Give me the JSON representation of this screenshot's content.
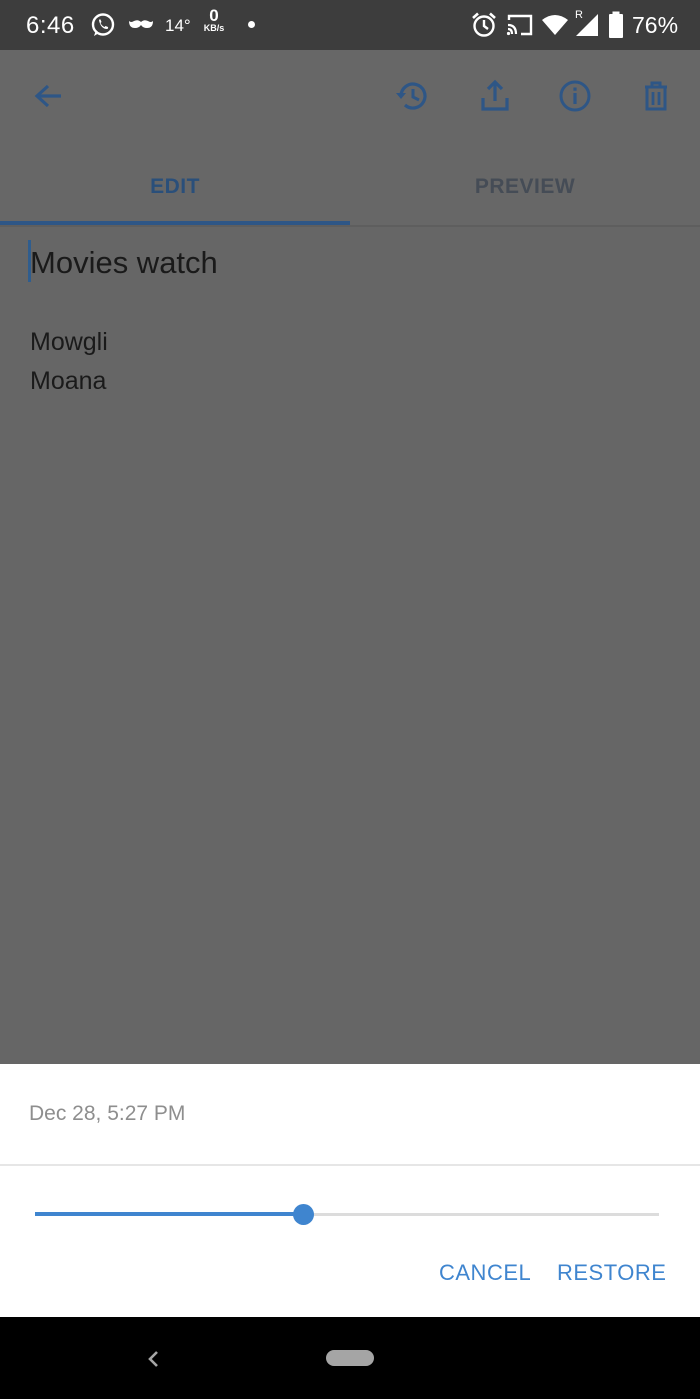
{
  "status_bar": {
    "time": "6:46",
    "temperature": "14°",
    "network_speed_value": "0",
    "network_speed_unit": "KB/s",
    "roaming_indicator": "R",
    "battery_percent": "76%",
    "icons": [
      "whatsapp-icon",
      "mustache-icon",
      "dot-icon",
      "alarm-icon",
      "cast-icon",
      "wifi-icon",
      "signal-icon",
      "battery-icon"
    ]
  },
  "app_bar": {
    "icons": [
      "back-arrow-icon",
      "history-icon",
      "share-icon",
      "info-icon",
      "delete-icon"
    ],
    "tabs": [
      {
        "label": "EDIT",
        "selected": true
      },
      {
        "label": "PREVIEW",
        "selected": false
      }
    ]
  },
  "note": {
    "title": "Movies watch",
    "lines": [
      "Mowgli",
      "Moana"
    ]
  },
  "history_sheet": {
    "timestamp": "Dec 28, 5:27 PM",
    "slider_position_fraction": 0.43,
    "cancel_label": "CANCEL",
    "restore_label": "RESTORE"
  },
  "colors": {
    "accent": "#3f85cf",
    "appbar_icon": "#2e5686",
    "scrim": "#666666",
    "status_bar": "#3d3d3d"
  },
  "nav_bar": {
    "icons": [
      "nav-back-icon",
      "nav-home-pill-icon"
    ]
  }
}
